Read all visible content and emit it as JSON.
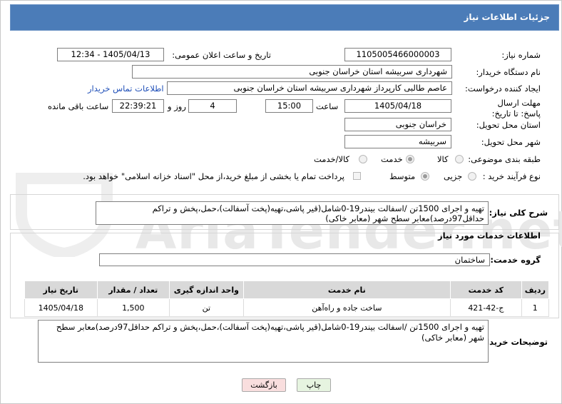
{
  "header": {
    "title": "جزئیات اطلاعات نیاز"
  },
  "fields": {
    "need_number_label": "شماره نیاز:",
    "need_number": "1105005466000003",
    "announce_label": "تاریخ و ساعت اعلان عمومی:",
    "announce_value": "1405/04/13 - 12:34",
    "buyer_org_label": "نام دستگاه خریدار:",
    "buyer_org": "شهرداری سربیشه استان خراسان جنوبی",
    "creator_label": "ایجاد کننده درخواست:",
    "creator": "عاصم طالبی کارپرداز شهرداری سربیشه استان خراسان جنوبی",
    "contact_link": "اطلاعات تماس خریدار",
    "deadline_label": "مهلت ارسال پاسخ: تا تاریخ:",
    "deadline_date": "1405/04/18",
    "time_label": "ساعت",
    "deadline_time": "15:00",
    "days_value": "4",
    "days_label": "روز و",
    "remaining_time": "22:39:21",
    "remaining_label": "ساعت باقی مانده",
    "province_label": "استان محل تحویل:",
    "province": "خراسان جنوبی",
    "city_label": "شهر محل تحویل:",
    "city": "سربیشه",
    "category_label": "طبقه بندی موضوعی:",
    "category_options": [
      "کالا",
      "خدمت",
      "کالا/خدمت"
    ],
    "process_label": "نوع فرآیند خرید :",
    "process_options": [
      "جزیی",
      "متوسط"
    ],
    "treasury_note": "پرداخت تمام یا بخشی از مبلغ خرید،از محل \"اسناد خزانه اسلامی\" خواهد بود."
  },
  "summary": {
    "label": "شرح کلی نیاز:",
    "text": "تهیه و اجرای 1500تن /اسفالت بیندر19-0شامل(قیر پاشی،تهیه(پخت آسفالت)،حمل،پخش و تراکم حداقل97درصد)معابر سطح شهر (معابر خاکی)"
  },
  "services": {
    "section_title": "اطلاعات خدمات مورد نیاز",
    "group_label": "گروه خدمت:",
    "group_value": "ساختمان",
    "columns": [
      "ردیف",
      "کد خدمت",
      "نام خدمت",
      "واحد اندازه گیری",
      "تعداد / مقدار",
      "تاریخ نیاز"
    ],
    "rows": [
      [
        "1",
        "ج-42-421",
        "ساخت جاده و راه‌آهن",
        "تن",
        "1,500",
        "1405/04/18"
      ]
    ]
  },
  "buyer_notes": {
    "label": "توضیحات خریدار:",
    "text": "تهیه و اجرای 1500تن /اسفالت بیندر19-0شامل(قیر پاشی،تهیه(پخت آسفالت)،حمل،پخش و تراکم حداقل97درصد)معابر سطح شهر (معابر خاکی)"
  },
  "buttons": {
    "print": "چاپ",
    "back": "بازگشت"
  },
  "watermark": "AriaTender.net",
  "colors": {
    "header": "#4b7cb8",
    "link": "#1f4fb8",
    "back_button": "#f9dede",
    "print_button": "#e6f4e0"
  }
}
